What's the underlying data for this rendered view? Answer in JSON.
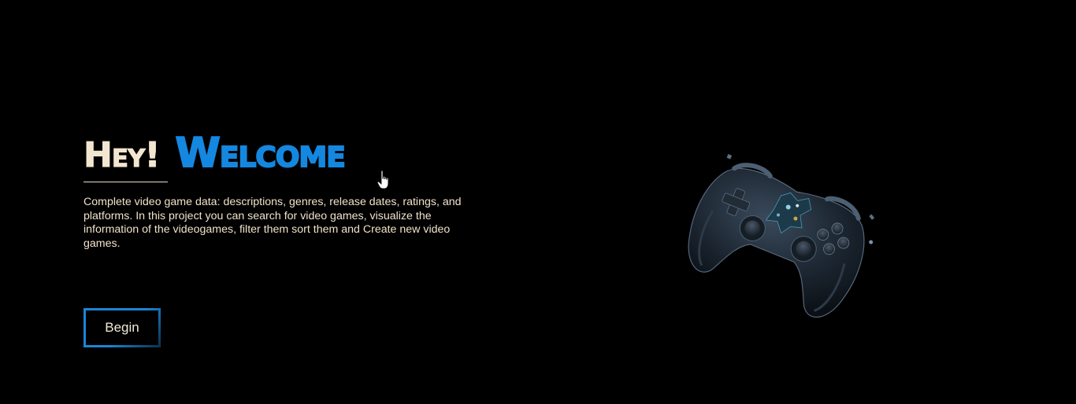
{
  "hero": {
    "greeting": "Hey!",
    "title": "Welcome",
    "description": "Complete video game data: descriptions, genres, release dates, ratings, and platforms. In this project you can search for video games, visualize the information of the videogames, filter them sort them and Create new video games."
  },
  "cta": {
    "begin_label": "Begin"
  },
  "icons": {
    "cursor": "hand-pointer-icon",
    "illustration": "game-controller-illustration"
  },
  "colors": {
    "background": "#000000",
    "accent": "#1487e0",
    "greeting": "#f3e6d1",
    "text": "#f1e2ca"
  }
}
